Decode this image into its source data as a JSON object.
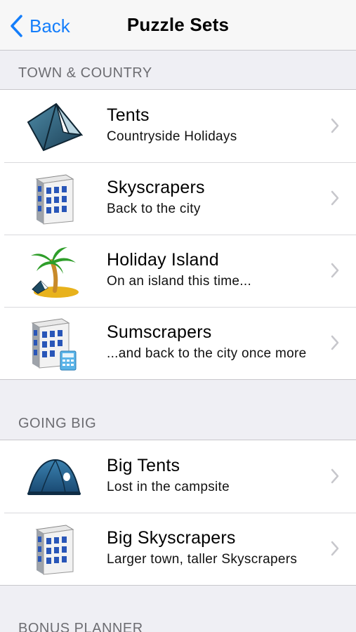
{
  "nav": {
    "back_label": "Back",
    "title": "Puzzle Sets"
  },
  "sections": [
    {
      "header": "TOWN & COUNTRY",
      "rows": [
        {
          "title": "Tents",
          "subtitle": "Countryside Holidays",
          "icon": "tent-icon"
        },
        {
          "title": "Skyscrapers",
          "subtitle": "Back to the city",
          "icon": "skyscraper-icon"
        },
        {
          "title": "Holiday Island",
          "subtitle": "On an island this time...",
          "icon": "palm-island-icon"
        },
        {
          "title": "Sumscrapers",
          "subtitle": "...and back to the city once more",
          "icon": "skyscraper-calculator-icon"
        }
      ]
    },
    {
      "header": "GOING BIG",
      "rows": [
        {
          "title": "Big Tents",
          "subtitle": "Lost in the campsite",
          "icon": "dome-tent-icon"
        },
        {
          "title": "Big Skyscrapers",
          "subtitle": "Larger town, taller Skyscrapers",
          "icon": "skyscraper-icon"
        }
      ]
    },
    {
      "header": "BONUS PLANNER",
      "rows": []
    }
  ],
  "colors": {
    "accent": "#147efb",
    "background": "#efeff4",
    "header_text": "#6d6d72"
  }
}
